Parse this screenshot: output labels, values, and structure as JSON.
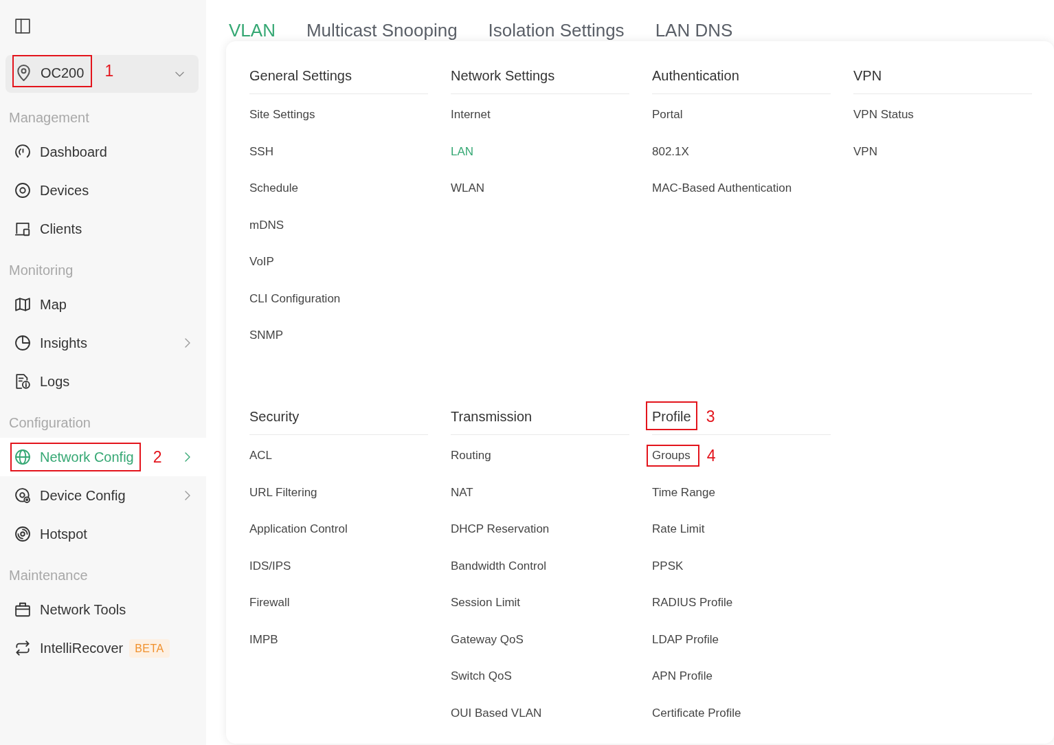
{
  "sidebar": {
    "site_selector": {
      "label": "OC200",
      "callout": "1"
    },
    "sections": [
      {
        "title": "Management",
        "items": [
          {
            "label": "Dashboard",
            "selected": false,
            "has_submenu": false
          },
          {
            "label": "Devices",
            "selected": false,
            "has_submenu": false
          },
          {
            "label": "Clients",
            "selected": false,
            "has_submenu": false
          }
        ]
      },
      {
        "title": "Monitoring",
        "items": [
          {
            "label": "Map",
            "selected": false,
            "has_submenu": false
          },
          {
            "label": "Insights",
            "selected": false,
            "has_submenu": true
          },
          {
            "label": "Logs",
            "selected": false,
            "has_submenu": false
          }
        ]
      },
      {
        "title": "Configuration",
        "items": [
          {
            "label": "Network Config",
            "selected": true,
            "has_submenu": true,
            "callout": "2"
          },
          {
            "label": "Device Config",
            "selected": false,
            "has_submenu": true
          },
          {
            "label": "Hotspot",
            "selected": false,
            "has_submenu": false
          }
        ]
      },
      {
        "title": "Maintenance",
        "items": [
          {
            "label": "Network Tools",
            "selected": false,
            "has_submenu": false
          },
          {
            "label": "IntelliRecover",
            "selected": false,
            "has_submenu": false,
            "badge": "BETA"
          }
        ]
      }
    ]
  },
  "tabs": [
    {
      "label": "VLAN",
      "selected": true
    },
    {
      "label": "Multicast Snooping",
      "selected": false
    },
    {
      "label": "Isolation Settings",
      "selected": false
    },
    {
      "label": "LAN DNS",
      "selected": false
    }
  ],
  "menu_panel": {
    "groups": [
      {
        "title": "General Settings",
        "items": [
          {
            "label": "Site Settings",
            "selected": false
          },
          {
            "label": "SSH",
            "selected": false
          },
          {
            "label": "Schedule",
            "selected": false
          },
          {
            "label": "mDNS",
            "selected": false
          },
          {
            "label": "VoIP",
            "selected": false
          },
          {
            "label": "CLI Configuration",
            "selected": false
          },
          {
            "label": "SNMP",
            "selected": false
          }
        ]
      },
      {
        "title": "Network Settings",
        "items": [
          {
            "label": "Internet",
            "selected": false
          },
          {
            "label": "LAN",
            "selected": true
          },
          {
            "label": "WLAN",
            "selected": false
          }
        ]
      },
      {
        "title": "Authentication",
        "items": [
          {
            "label": "Portal",
            "selected": false
          },
          {
            "label": "802.1X",
            "selected": false
          },
          {
            "label": "MAC-Based Authentication",
            "selected": false
          }
        ]
      },
      {
        "title": "VPN",
        "items": [
          {
            "label": "VPN Status",
            "selected": false
          },
          {
            "label": "VPN",
            "selected": false
          }
        ]
      },
      {
        "title": "Security",
        "items": [
          {
            "label": "ACL",
            "selected": false
          },
          {
            "label": "URL Filtering",
            "selected": false
          },
          {
            "label": "Application Control",
            "selected": false
          },
          {
            "label": "IDS/IPS",
            "selected": false
          },
          {
            "label": "Firewall",
            "selected": false
          },
          {
            "label": "IMPB",
            "selected": false
          }
        ]
      },
      {
        "title": "Transmission",
        "items": [
          {
            "label": "Routing",
            "selected": false
          },
          {
            "label": "NAT",
            "selected": false
          },
          {
            "label": "DHCP Reservation",
            "selected": false
          },
          {
            "label": "Bandwidth Control",
            "selected": false
          },
          {
            "label": "Session Limit",
            "selected": false
          },
          {
            "label": "Gateway QoS",
            "selected": false
          },
          {
            "label": "Switch QoS",
            "selected": false
          },
          {
            "label": "OUI Based VLAN",
            "selected": false
          }
        ]
      },
      {
        "title": "Profile",
        "callout": "3",
        "items": [
          {
            "label": "Groups",
            "selected": false,
            "callout": "4"
          },
          {
            "label": "Time Range",
            "selected": false
          },
          {
            "label": "Rate Limit",
            "selected": false
          },
          {
            "label": "PPSK",
            "selected": false
          },
          {
            "label": "RADIUS Profile",
            "selected": false
          },
          {
            "label": "LDAP Profile",
            "selected": false
          },
          {
            "label": "APN Profile",
            "selected": false
          },
          {
            "label": "Certificate Profile",
            "selected": false
          }
        ]
      }
    ]
  }
}
